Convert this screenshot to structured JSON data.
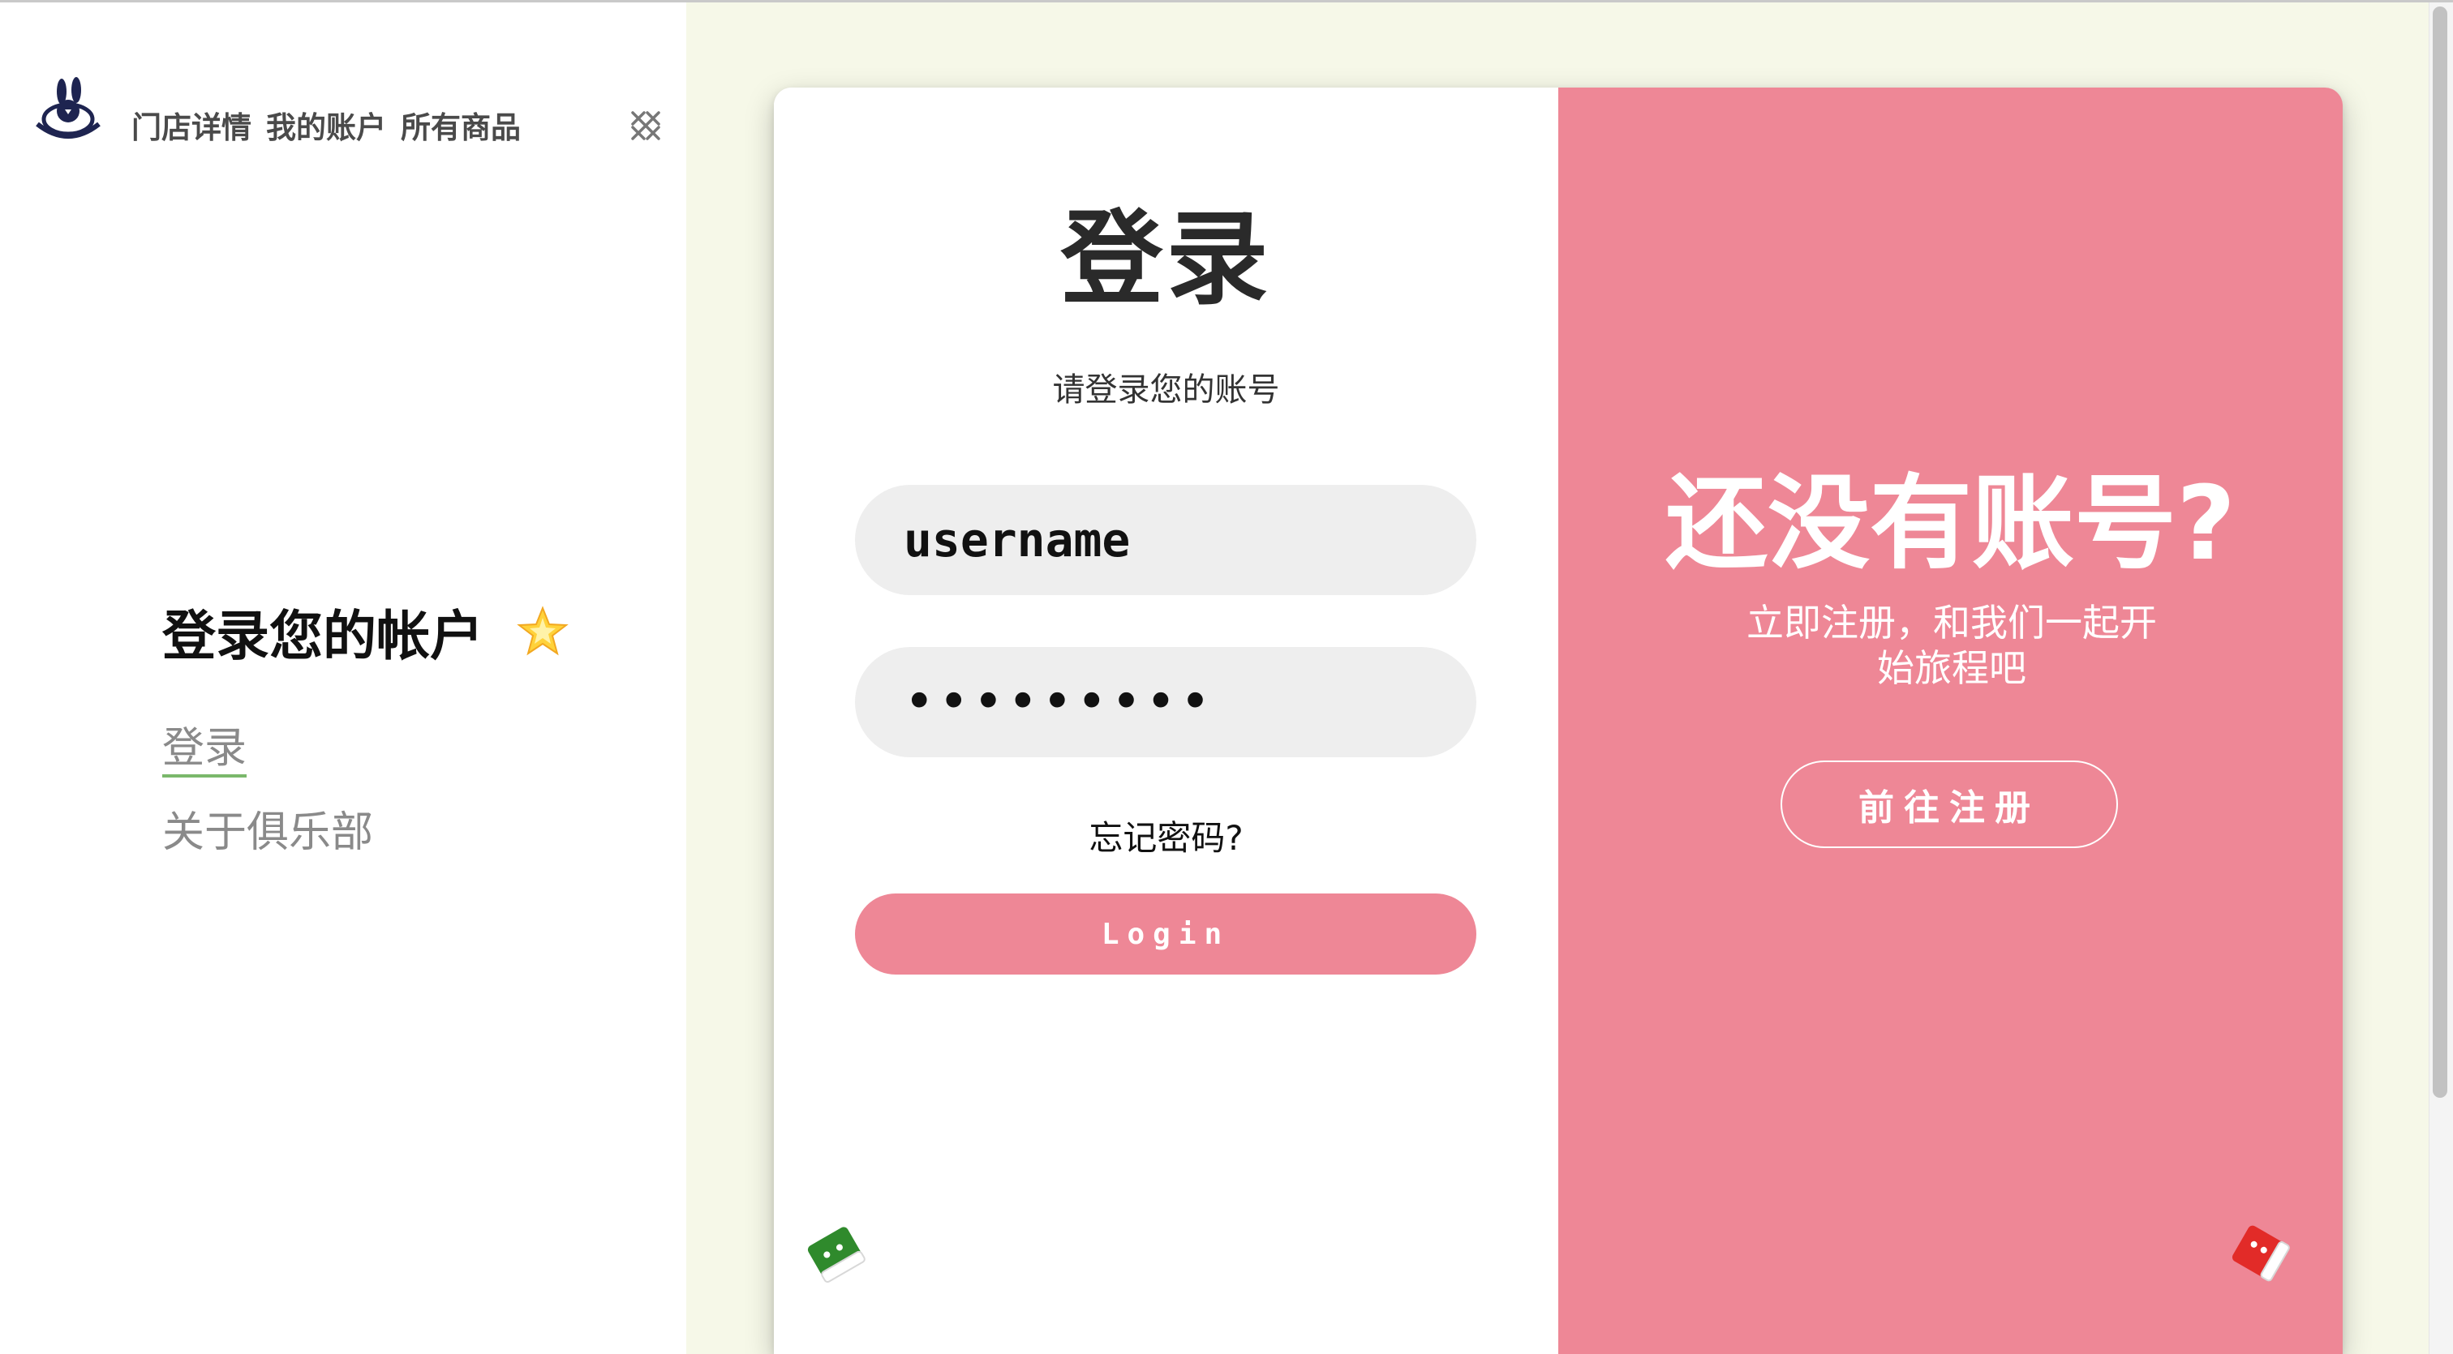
{
  "nav": {
    "items": [
      "门店详情",
      "我的账户",
      "所有商品"
    ]
  },
  "sidebar": {
    "title": "登录您的帐户",
    "menu": [
      {
        "label": "登录",
        "active": true
      },
      {
        "label": "关于俱乐部",
        "active": false
      }
    ]
  },
  "login": {
    "title": "登录",
    "subtitle": "请登录您的账号",
    "username_value": "username",
    "password_value": "•••••••••",
    "forgot_label": "忘记密码?",
    "login_label": "Login"
  },
  "register": {
    "title": "还没有账号?",
    "text": "立即注册，和我们一起开始旅程吧",
    "button_label": "前往注册"
  },
  "icons": {
    "logo": "rabbit-logo",
    "close": "close-icon",
    "star": "star-icon",
    "green_deco": "green-robot-icon",
    "red_deco": "red-robot-icon"
  },
  "colors": {
    "accent_pink": "#ee8796",
    "page_bg": "#f6f8e8",
    "active_underline": "#7ab86b"
  }
}
